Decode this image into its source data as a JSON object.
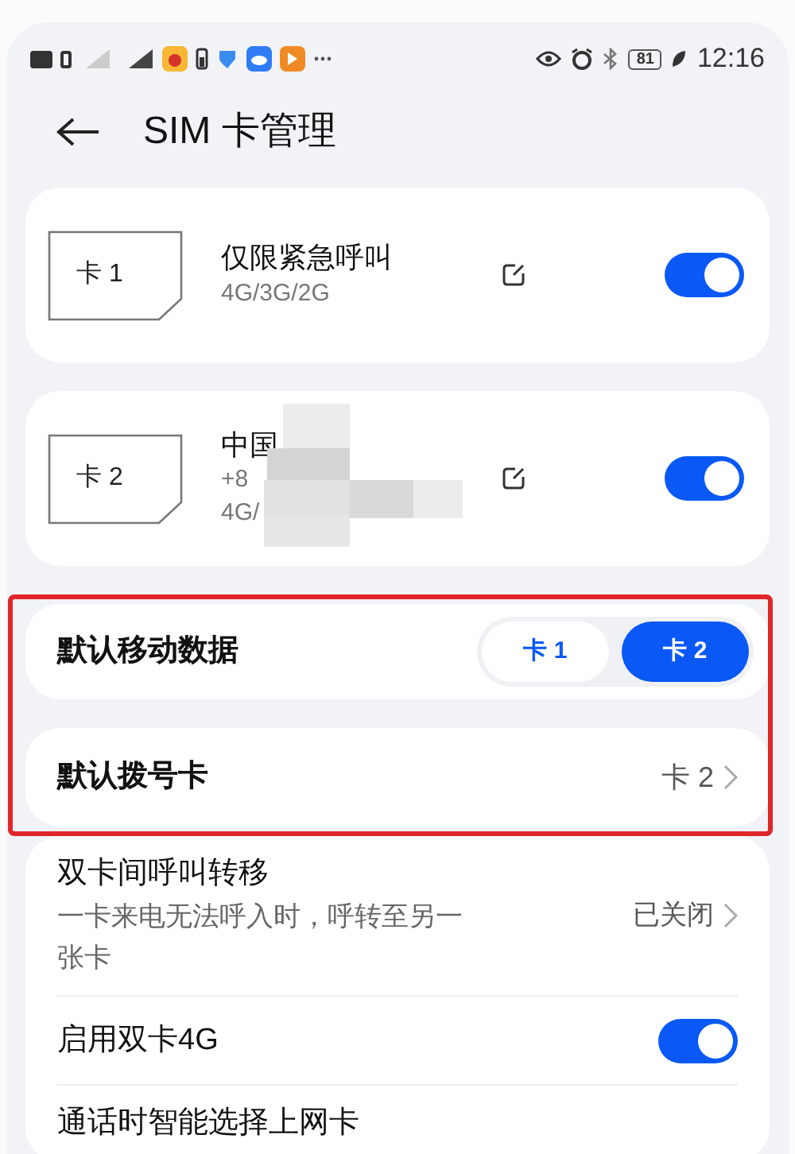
{
  "status_bar": {
    "time": "12:16",
    "battery": "81"
  },
  "header": {
    "title": "SIM 卡管理"
  },
  "sim_cards": [
    {
      "slot": "卡 1",
      "name": "仅限紧急呼叫",
      "detail": "4G/3G/2G",
      "on": true,
      "redacted": false
    },
    {
      "slot": "卡 2",
      "name": "中国",
      "number": "+8",
      "detail": "4G/",
      "on": true,
      "redacted": true
    }
  ],
  "default_data": {
    "label": "默认移动数据",
    "options": [
      {
        "label": "卡 1",
        "selected": false
      },
      {
        "label": "卡 2",
        "selected": true
      }
    ]
  },
  "default_dial": {
    "label": "默认拨号卡",
    "value": "卡 2"
  },
  "highlight_defaults": true,
  "settings": [
    {
      "kind": "link",
      "title": "双卡间呼叫转移",
      "description": "一卡来电无法呼入时，呼转至另一张卡",
      "value": "已关闭"
    },
    {
      "kind": "toggle",
      "title": "启用双卡4G",
      "on": true
    },
    {
      "kind": "plain",
      "title": "通话时智能选择上网卡"
    }
  ]
}
